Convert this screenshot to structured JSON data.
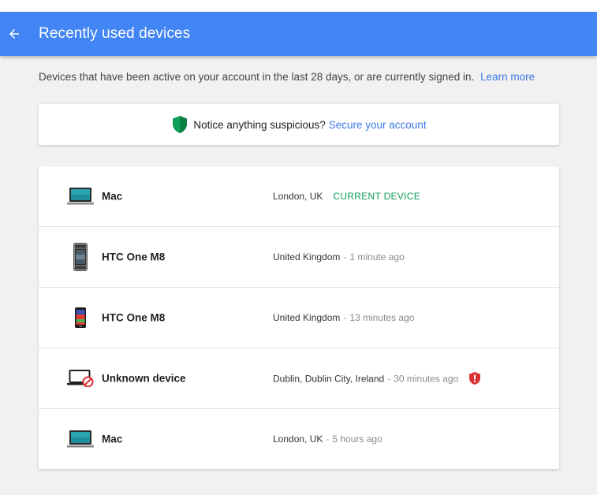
{
  "header": {
    "title": "Recently used devices",
    "back_icon": "arrow-left-icon",
    "color": "#4285f4"
  },
  "description": {
    "text": "Devices that have been active on your account in the last 28 days, or are currently signed in.",
    "link": "Learn more"
  },
  "notice": {
    "icon": "green-shield-icon",
    "text": "Notice anything suspicious?",
    "link": "Secure your account"
  },
  "devices": [
    {
      "name": "Mac",
      "icon": "laptop-icon",
      "location": "London, UK",
      "status": "CURRENT DEVICE"
    },
    {
      "name": "HTC One M8",
      "icon": "htc-phone-icon",
      "location": "United Kingdom",
      "time": "1 minute ago"
    },
    {
      "name": "HTC One M8",
      "icon": "android-phone-icon",
      "location": "United Kingdom",
      "time": "13 minutes ago"
    },
    {
      "name": "Unknown device",
      "icon": "unknown-device-icon",
      "location": "Dublin, Dublin City, Ireland",
      "time": "30 minutes ago",
      "alert": "red-shield-alert-icon"
    },
    {
      "name": "Mac",
      "icon": "laptop-icon",
      "location": "London, UK",
      "time": "5 hours ago"
    }
  ],
  "colors": {
    "accent": "#4285f4",
    "link": "#3b78e7",
    "current": "#0f9d58",
    "alert": "#db3236"
  }
}
